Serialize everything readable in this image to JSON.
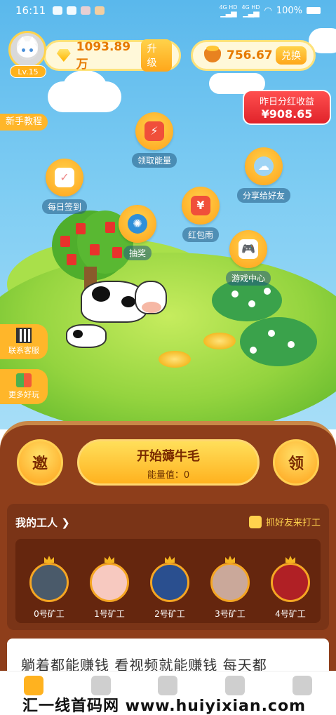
{
  "status_bar": {
    "time": "16:11",
    "battery": "100%",
    "network": "4G HD"
  },
  "user": {
    "level": "Lv.15"
  },
  "wallet": {
    "diamonds": "1093.89万",
    "upgrade_label": "升级",
    "coins": "756.67",
    "exchange_label": "兑换"
  },
  "bonus": {
    "title": "昨日分红收益",
    "value": "¥908.65"
  },
  "tutorial_label": "新手教程",
  "actions": {
    "energy": "领取能量",
    "checkin": "每日签到",
    "lottery": "抽奖",
    "red_packet": "红包雨",
    "share": "分享给好友",
    "games": "游戏中心"
  },
  "side": {
    "support": "联系客服",
    "more": "更多好玩"
  },
  "controls": {
    "invite": "邀",
    "claim": "领",
    "start_title": "开始薅牛毛",
    "energy_text": "能量值：0"
  },
  "workers": {
    "title": "我的工人",
    "invite_label": "抓好友来打工",
    "items": [
      {
        "label": "0号矿工",
        "color": "#4a5a6a"
      },
      {
        "label": "1号矿工",
        "color": "#f7c9c0"
      },
      {
        "label": "2号矿工",
        "color": "#2a4f8f"
      },
      {
        "label": "3号矿工",
        "color": "#caa89a"
      },
      {
        "label": "4号矿工",
        "color": "#b02025"
      }
    ]
  },
  "marquee_text": "躺着都能赚钱  看视频就能赚钱  每天都",
  "watermark": "汇一线首码网 www.huiyixian.com",
  "colors": {
    "accent": "#ffb21f",
    "panel": "#8e3e1b",
    "bonus": "#e0232a"
  }
}
